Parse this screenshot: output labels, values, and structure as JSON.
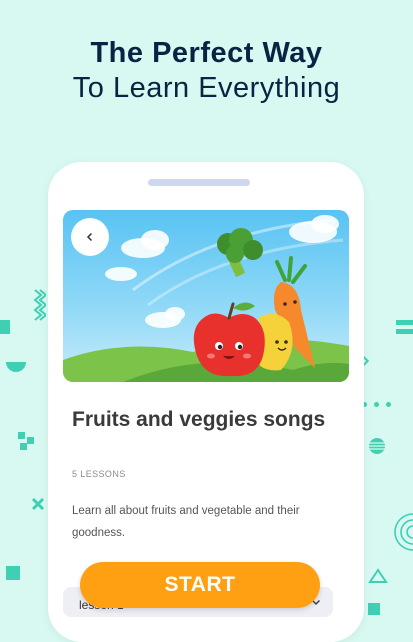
{
  "headline": {
    "line1": "The Perfect Way",
    "line2": "To Learn Everything"
  },
  "course": {
    "title": "Fruits and veggies songs",
    "lesson_count": "5 LESSONS",
    "description": "Learn all about fruits and vegetable and their goodness."
  },
  "lessons": [
    {
      "label": "lesson 1"
    }
  ],
  "actions": {
    "start_label": "START"
  },
  "icons": {
    "back": "chevron-left-icon",
    "expand": "chevron-down-icon"
  },
  "colors": {
    "background": "#d7f9f1",
    "heading": "#0b2343",
    "accent": "#fea012",
    "decor": "#3fd0b4"
  }
}
